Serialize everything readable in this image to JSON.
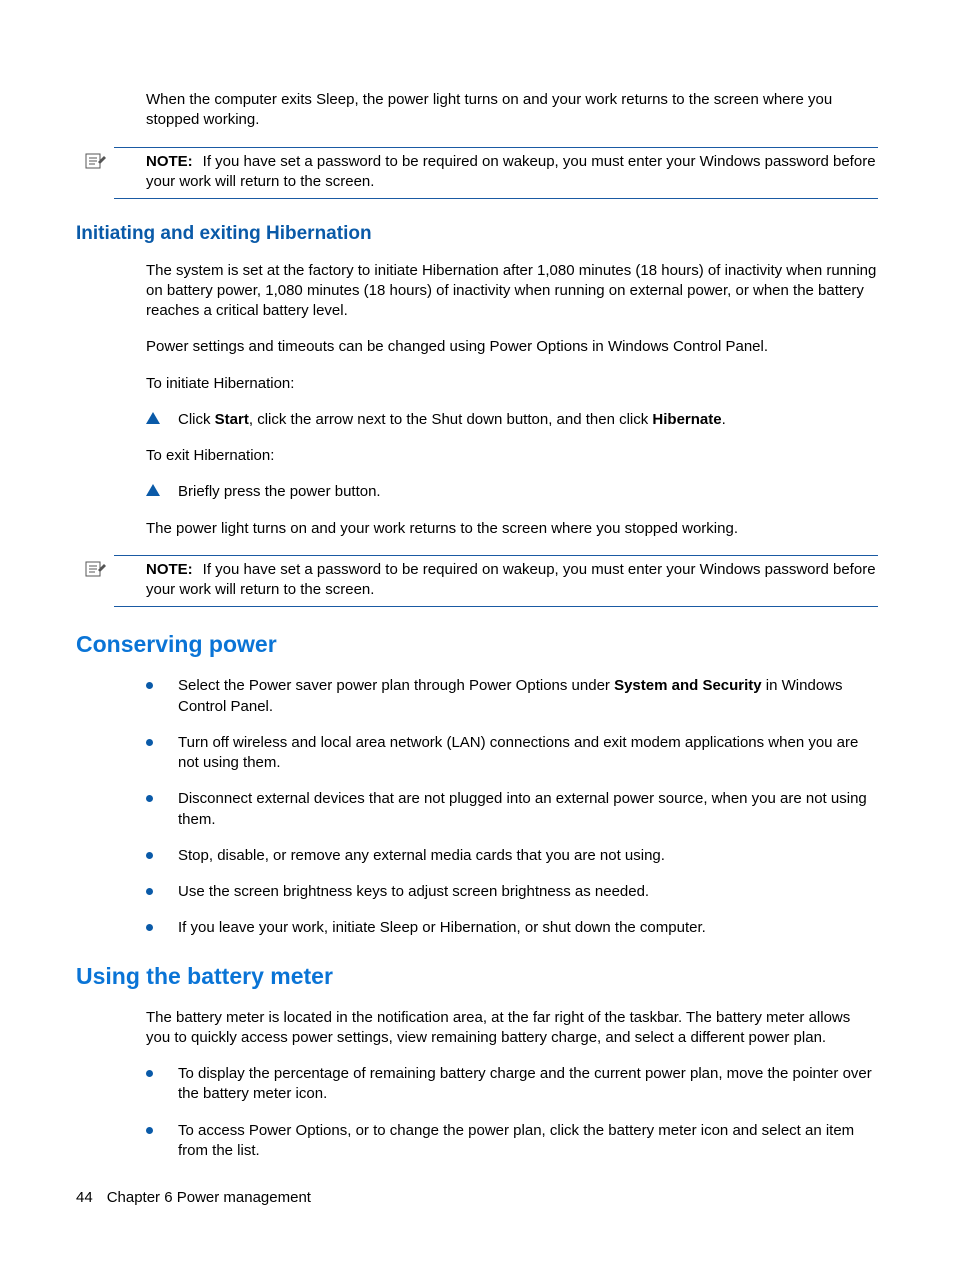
{
  "intro": "When the computer exits Sleep, the power light turns on and your work returns to the screen where you stopped working.",
  "note1": {
    "label": "NOTE:",
    "text": "If you have set a password to be required on wakeup, you must enter your Windows password before your work will return to the screen."
  },
  "sec1": {
    "title": "Initiating and exiting Hibernation",
    "p1": "The system is set at the factory to initiate Hibernation after 1,080 minutes (18 hours) of inactivity when running on battery power, 1,080 minutes (18 hours) of inactivity when running on external power, or when the battery reaches a critical battery level.",
    "p2": "Power settings and timeouts can be changed using Power Options in Windows Control Panel.",
    "p3": "To initiate Hibernation:",
    "step1_pre": "Click ",
    "step1_b1": "Start",
    "step1_mid": ", click the arrow next to the Shut down button, and then click ",
    "step1_b2": "Hibernate",
    "step1_post": ".",
    "p4": "To exit Hibernation:",
    "step2": "Briefly press the power button.",
    "p5": "The power light turns on and your work returns to the screen where you stopped working."
  },
  "note2": {
    "label": "NOTE:",
    "text": "If you have set a password to be required on wakeup, you must enter your Windows password before your work will return to the screen."
  },
  "sec2": {
    "title": "Conserving power",
    "b1_pre": "Select the Power saver power plan through Power Options under ",
    "b1_b": "System and Security",
    "b1_post": " in Windows Control Panel.",
    "b2": "Turn off wireless and local area network (LAN) connections and exit modem applications when you are not using them.",
    "b3": "Disconnect external devices that are not plugged into an external power source, when you are not using them.",
    "b4": "Stop, disable, or remove any external media cards that you are not using.",
    "b5": "Use the screen brightness keys to adjust screen brightness as needed.",
    "b6": "If you leave your work, initiate Sleep or Hibernation, or shut down the computer."
  },
  "sec3": {
    "title": "Using the battery meter",
    "p1": "The battery meter is located in the notification area, at the far right of the taskbar. The battery meter allows you to quickly access power settings, view remaining battery charge, and select a different power plan.",
    "b1": "To display the percentage of remaining battery charge and the current power plan, move the pointer over the battery meter icon.",
    "b2": "To access Power Options, or to change the power plan, click the battery meter icon and select an item from the list."
  },
  "footer": {
    "page": "44",
    "chapter": "Chapter 6   Power management"
  }
}
